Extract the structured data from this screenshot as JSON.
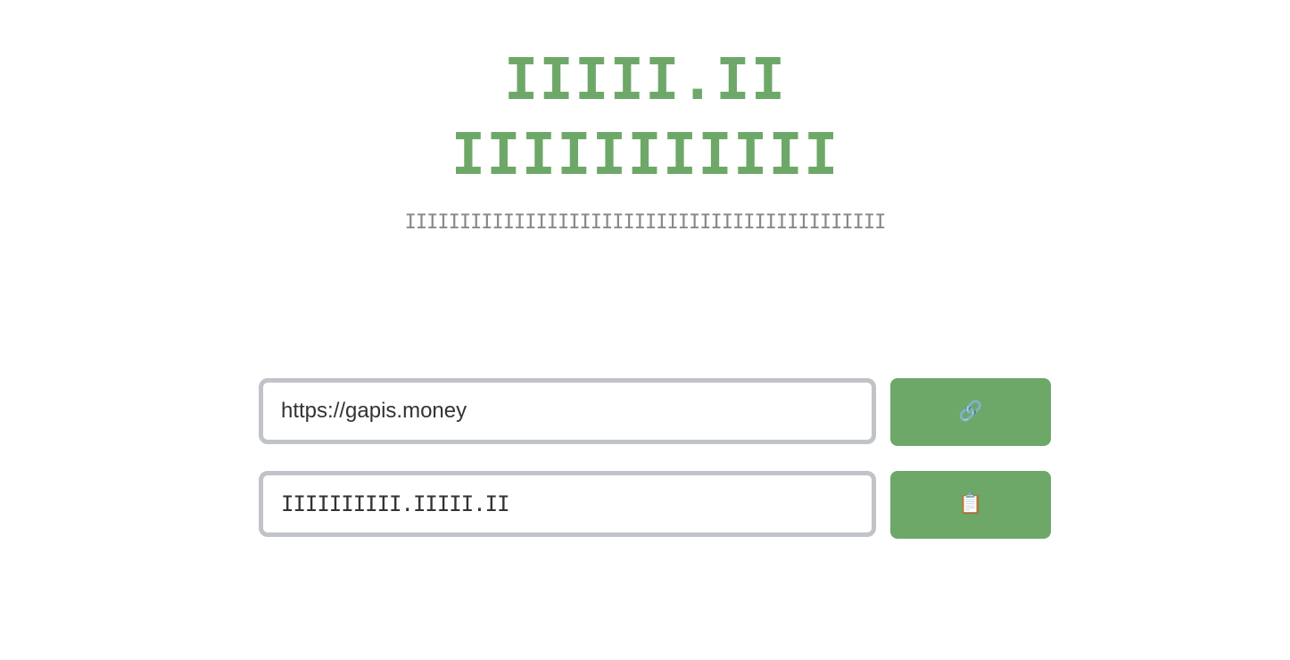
{
  "header": {
    "title_line_1": "IIIII.II",
    "title_line_2": "IIIIIIIIIII",
    "subtitle": "IIIIIIIIIIIIIIIIIIIIIIIIIIIIIIIIIIIIIIIIIIII"
  },
  "form": {
    "url_input_value": "https://gapis.money",
    "short_url_value": "IIIIIIIIII.IIIII.II",
    "shorten_button_icon": "🔗",
    "copy_button_icon": "📋"
  },
  "colors": {
    "accent": "#6da869",
    "input_border": "#c0c4c8",
    "subtitle": "#888888"
  },
  "icons": {
    "shorten": "link-icon",
    "copy": "clipboard-icon"
  }
}
